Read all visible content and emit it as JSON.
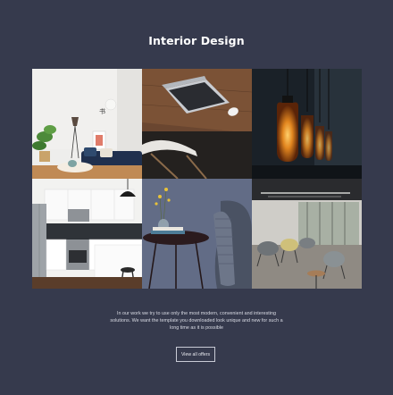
{
  "section": {
    "title": "Interior Design",
    "description": "In our work we try to use only the most modern, convenient and interesting solutions. We want the template you downloaded look unique and new for such a long time as it is possible",
    "button_label": "View all offers"
  },
  "colors": {
    "background": "#363a4d",
    "button_border": "#c9cbd6"
  },
  "gallery": [
    {
      "name": "living-room-photo",
      "subject": "bright living room with plant, floor lamp and sofa"
    },
    {
      "name": "laptop-desk-photo",
      "subject": "laptop and mouse on wooden desk with white chair"
    },
    {
      "name": "pendant-lamps-photo",
      "subject": "amber glass pendant light bulbs"
    },
    {
      "name": "kitchen-photo",
      "subject": "white kitchen with island and stool"
    },
    {
      "name": "side-table-photo",
      "subject": "round side table with flowers and books beside armchair"
    },
    {
      "name": "office-lounge-photo",
      "subject": "modern office lounge with grey chairs"
    }
  ]
}
